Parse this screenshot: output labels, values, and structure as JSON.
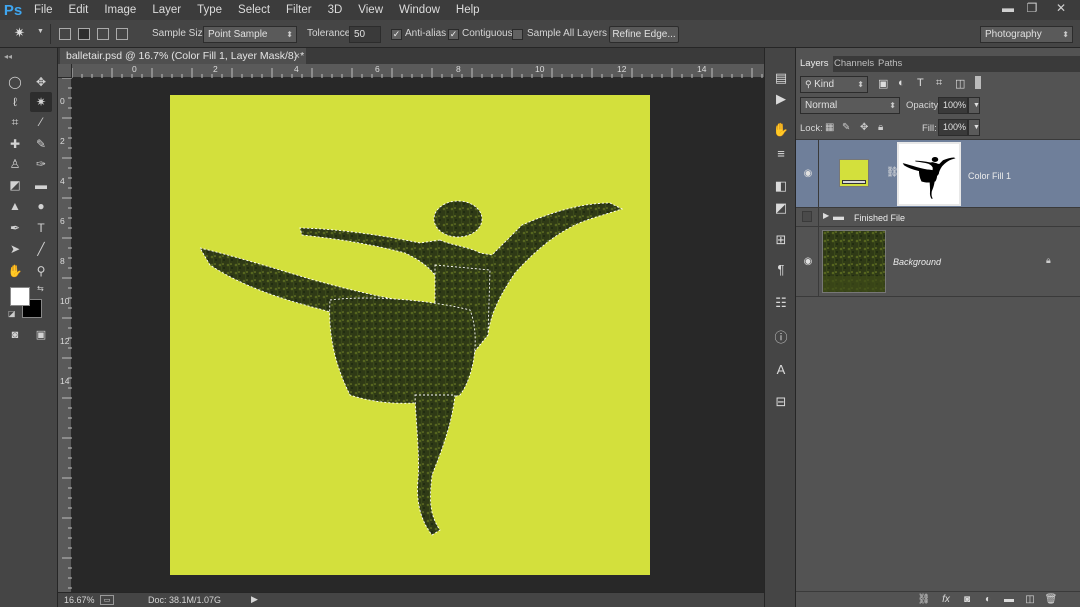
{
  "app": {
    "logo": "Ps"
  },
  "menu": [
    "File",
    "Edit",
    "Image",
    "Layer",
    "Type",
    "Select",
    "Filter",
    "3D",
    "View",
    "Window",
    "Help"
  ],
  "window_controls": {
    "minimize": "▬",
    "restore": "❐",
    "close": "✕"
  },
  "options": {
    "sample_size_label": "Sample Size:",
    "sample_size_value": "Point Sample",
    "tolerance_label": "Tolerance:",
    "tolerance_value": "50",
    "anti_alias_label": "Anti-alias",
    "anti_alias_checked": true,
    "contiguous_label": "Contiguous",
    "contiguous_checked": true,
    "sample_all_label": "Sample All Layers",
    "sample_all_checked": false,
    "refine_edge_label": "Refine Edge...",
    "workspace_value": "Photography"
  },
  "document": {
    "tab_title": "balletair.psd @ 16.7% (Color Fill 1, Layer Mask/8) *",
    "tab_close": "×",
    "ruler_h": [
      "0",
      "2",
      "4",
      "6",
      "8",
      "10",
      "12",
      "14"
    ],
    "ruler_v": [
      "0",
      "2",
      "4",
      "6",
      "8",
      "10",
      "12",
      "14"
    ],
    "fill_color": "#d3e03c"
  },
  "status": {
    "zoom": "16.67%",
    "doc_size": "Doc: 38.1M/1.07G"
  },
  "layers_panel": {
    "tabs": [
      "Layers",
      "Channels",
      "Paths"
    ],
    "filter_kind": "Kind",
    "blend_mode": "Normal",
    "opacity_label": "Opacity:",
    "opacity_value": "100%",
    "lock_label": "Lock:",
    "fill_label": "Fill:",
    "fill_value": "100%",
    "layers": [
      {
        "name": "Color Fill 1",
        "visible": true,
        "selected": true
      },
      {
        "name": "Finished File",
        "visible": false,
        "selected": false
      },
      {
        "name": "Background",
        "visible": true,
        "selected": false
      }
    ]
  },
  "colors": {
    "accent": "#3fa6f0",
    "selected_layer": "#6f7f9a",
    "foreground": "#ffffff",
    "background": "#000000"
  }
}
